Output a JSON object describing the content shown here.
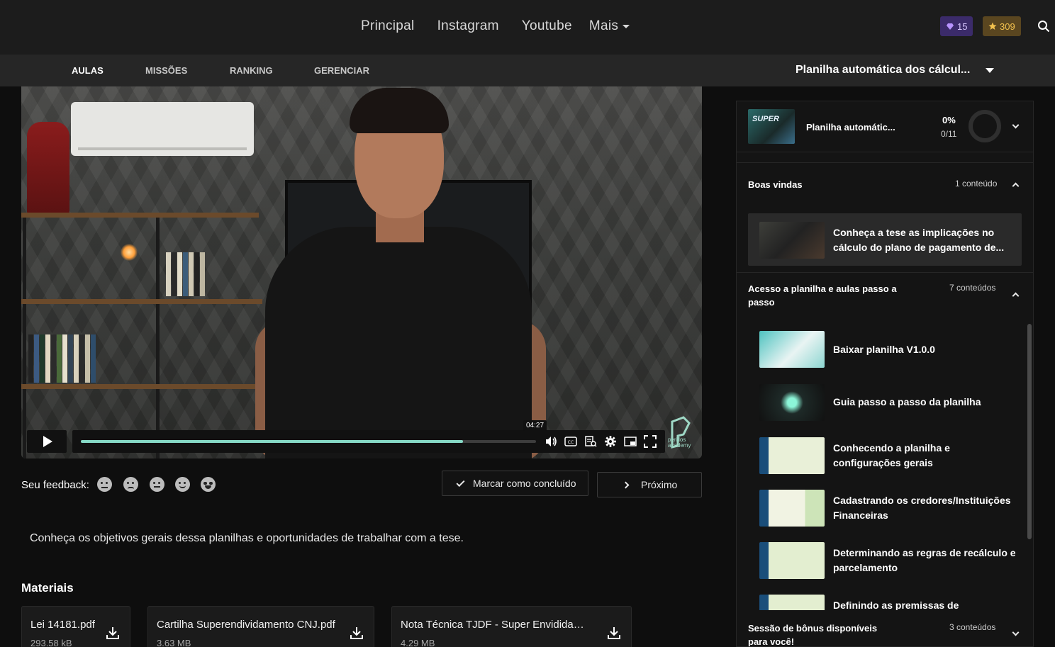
{
  "nav": {
    "links": [
      "Principal",
      "Instagram",
      "Youtube",
      "Mais"
    ],
    "gem_count": "15",
    "star_count": "309"
  },
  "tabs": [
    "AULAS",
    "MISSÕES",
    "RANKING",
    "GERENCIAR"
  ],
  "course_selector": "Planilha automática dos cálcul...",
  "video": {
    "current_time": "04:27",
    "progress": 0.84,
    "brand": [
      "perillos",
      "academy"
    ]
  },
  "feedback": {
    "label": "Seu feedback:"
  },
  "actions": {
    "mark_done": "Marcar como concluído",
    "next": "Próximo"
  },
  "description": "Conheça os objetivos gerais dessa planilhas e oportunidades de trabalhar com a tese.",
  "materials": {
    "title": "Materiais",
    "items": [
      {
        "name": "Lei 14181.pdf",
        "size": "293.58 kB"
      },
      {
        "name": "Cartilha Superendividamento CNJ.pdf",
        "size": "3.63 MB"
      },
      {
        "name": "Nota Técnica TJDF - Super Envididam...",
        "size": "4.29 MB"
      }
    ]
  },
  "sidebar": {
    "course": {
      "name": "Planilha automátic...",
      "percent": "0%",
      "count": "0/11"
    },
    "modules": [
      {
        "title": "Boas vindas",
        "count": "1 conteúdo",
        "lessons": [
          "Conheça a tese as implicações no cálculo do plano de pagamento de..."
        ]
      },
      {
        "title": "Acesso a planilha e aulas passo a passo",
        "count": "7 conteúdos",
        "lessons": [
          "Baixar planilha V1.0.0",
          "Guia passo a passo da planilha",
          "Conhecendo a planilha e configurações gerais",
          "Cadastrando os credores/Instituições Financeiras",
          "Determinando as regras de recálculo e parcelamento",
          "Definindo as premissas de"
        ]
      },
      {
        "title": "Sessão de bônus disponíveis para você!",
        "count": "3 conteúdos"
      }
    ]
  },
  "colors": {
    "accent": "#86d9c6",
    "gem_badge": "#3b2b6a",
    "star_badge": "#5a4620"
  }
}
